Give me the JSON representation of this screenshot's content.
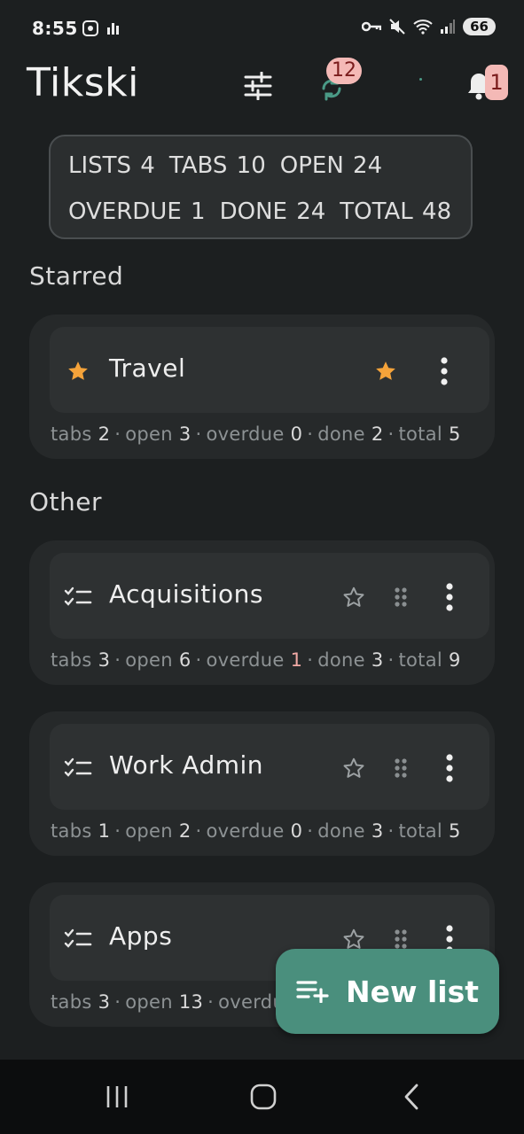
{
  "status_bar": {
    "time": "8:55",
    "battery": "66",
    "left_icons": [
      "screenshot-icon",
      "signal-bars-icon"
    ],
    "right_icons": [
      "vpn-key-icon",
      "mute-icon",
      "wifi-icon",
      "cell-signal-icon"
    ]
  },
  "app": {
    "title": "Tikski",
    "sync_badge": "12",
    "notif_badge": "1"
  },
  "stats": {
    "row1": [
      "LISTS 4",
      "TABS 10",
      "OPEN 24"
    ],
    "row2": [
      "OVERDUE 1",
      "DONE 24",
      "TOTAL 48"
    ]
  },
  "sections": {
    "starred": "Starred",
    "other": "Other"
  },
  "lists": [
    {
      "name": "Travel",
      "tabs_label": "tabs",
      "tabs": "2",
      "open_label": "open",
      "open": "3",
      "overdue_label": "overdue",
      "overdue": "0",
      "done_label": "done",
      "done": "2",
      "total_label": "total",
      "total": "5"
    },
    {
      "name": "Acquisitions",
      "tabs_label": "tabs",
      "tabs": "3",
      "open_label": "open",
      "open": "6",
      "overdue_label": "overdue",
      "overdue": "1",
      "done_label": "done",
      "done": "3",
      "total_label": "total",
      "total": "9"
    },
    {
      "name": "Work Admin",
      "tabs_label": "tabs",
      "tabs": "1",
      "open_label": "open",
      "open": "2",
      "overdue_label": "overdue",
      "overdue": "0",
      "done_label": "done",
      "done": "3",
      "total_label": "total",
      "total": "5"
    },
    {
      "name": "Apps",
      "tabs_label": "tabs",
      "tabs": "3",
      "open_label": "open",
      "open": "13",
      "overdue_label": "overdu"
    }
  ],
  "fab": {
    "label": "New list"
  },
  "colors": {
    "star": "#f5a33a",
    "fab": "#4a8f7d",
    "badge": "#f4b9b6",
    "overdue_highlight": "#f0a9a5"
  }
}
